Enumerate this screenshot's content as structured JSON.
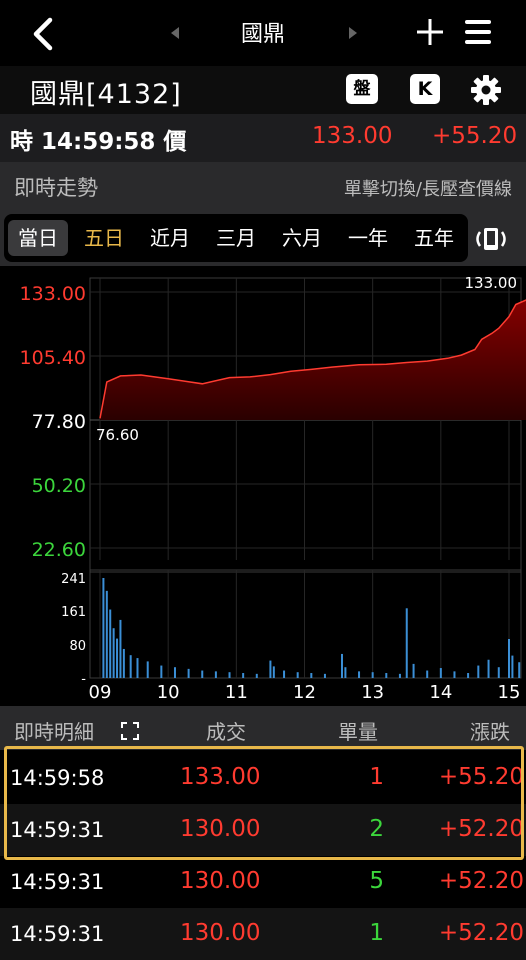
{
  "nav": {
    "title": "國鼎"
  },
  "stock": {
    "name_code": "國鼎[4132]",
    "pan_label": "盤",
    "k_label": "K"
  },
  "quote": {
    "time_label": "時 14:59:58 價",
    "price": "133.00",
    "change": "+55.20"
  },
  "section": {
    "title": "即時走勢",
    "hint": "單擊切換/長壓查價線"
  },
  "tabs": [
    {
      "label": "當日",
      "selected": true
    },
    {
      "label": "五日",
      "active": true
    },
    {
      "label": "近月"
    },
    {
      "label": "三月"
    },
    {
      "label": "六月"
    },
    {
      "label": "一年"
    },
    {
      "label": "五年"
    }
  ],
  "chart_data": {
    "type": "area",
    "price_axis": [
      "133.00",
      "105.40",
      "77.80",
      "50.20",
      "22.60"
    ],
    "price_axis_colors": [
      "#ff3b30",
      "#ff3b30",
      "#ffffff",
      "#3cd63c",
      "#3cd63c"
    ],
    "high_label": "133.00",
    "low_label": "76.60",
    "volume_axis": [
      "241",
      "161",
      "80",
      "-"
    ],
    "x_labels": [
      "09",
      "10",
      "11",
      "12",
      "13",
      "14",
      "15"
    ],
    "ylim_price": [
      22.6,
      133.0
    ],
    "ylim_volume": [
      0,
      241
    ],
    "price_series": [
      [
        0,
        78.5
      ],
      [
        0.1,
        94.2
      ],
      [
        0.3,
        96.8
      ],
      [
        0.6,
        97.2
      ],
      [
        1.0,
        95.6
      ],
      [
        1.5,
        93.4
      ],
      [
        1.9,
        96.1
      ],
      [
        2.2,
        96.4
      ],
      [
        2.5,
        97.4
      ],
      [
        2.8,
        98.8
      ],
      [
        3.1,
        99.6
      ],
      [
        3.4,
        100.6
      ],
      [
        3.8,
        101.6
      ],
      [
        4.2,
        101.8
      ],
      [
        4.5,
        102.6
      ],
      [
        4.8,
        103.2
      ],
      [
        5.1,
        104.4
      ],
      [
        5.3,
        105.8
      ],
      [
        5.5,
        108.2
      ],
      [
        5.6,
        112.6
      ],
      [
        5.75,
        115.2
      ],
      [
        5.85,
        117.4
      ],
      [
        6.0,
        122.4
      ],
      [
        6.1,
        127.6
      ],
      [
        6.35,
        130.8
      ],
      [
        6.6,
        130.4
      ],
      [
        6.9,
        128.6
      ],
      [
        7.2,
        127.2
      ],
      [
        7.5,
        129.8
      ],
      [
        7.8,
        130.4
      ],
      [
        8.1,
        130.6
      ],
      [
        8.4,
        130.2
      ],
      [
        8.7,
        131.4
      ],
      [
        9.0,
        131.6
      ],
      [
        9.25,
        133.0
      ]
    ],
    "volume_series": [
      [
        0.05,
        241
      ],
      [
        0.1,
        210
      ],
      [
        0.15,
        165
      ],
      [
        0.2,
        120
      ],
      [
        0.25,
        95
      ],
      [
        0.3,
        140
      ],
      [
        0.35,
        70
      ],
      [
        0.45,
        55
      ],
      [
        0.55,
        48
      ],
      [
        0.7,
        40
      ],
      [
        0.9,
        30
      ],
      [
        1.1,
        26
      ],
      [
        1.3,
        22
      ],
      [
        1.5,
        18
      ],
      [
        1.7,
        16
      ],
      [
        1.9,
        14
      ],
      [
        2.1,
        12
      ],
      [
        2.3,
        10
      ],
      [
        2.5,
        42
      ],
      [
        2.55,
        28
      ],
      [
        2.7,
        18
      ],
      [
        2.9,
        14
      ],
      [
        3.1,
        12
      ],
      [
        3.3,
        10
      ],
      [
        3.55,
        58
      ],
      [
        3.6,
        26
      ],
      [
        3.8,
        16
      ],
      [
        4.0,
        14
      ],
      [
        4.2,
        12
      ],
      [
        4.4,
        10
      ],
      [
        4.5,
        168
      ],
      [
        4.6,
        34
      ],
      [
        4.8,
        18
      ],
      [
        5.0,
        24
      ],
      [
        5.2,
        16
      ],
      [
        5.4,
        12
      ],
      [
        5.55,
        30
      ],
      [
        5.7,
        44
      ],
      [
        5.85,
        26
      ],
      [
        6.0,
        94
      ],
      [
        6.05,
        54
      ],
      [
        6.15,
        38
      ],
      [
        6.3,
        22
      ],
      [
        6.45,
        18
      ],
      [
        6.6,
        16
      ],
      [
        6.75,
        14
      ],
      [
        6.9,
        12
      ],
      [
        7.05,
        10
      ],
      [
        7.2,
        8
      ],
      [
        7.35,
        10
      ],
      [
        7.5,
        12
      ],
      [
        7.65,
        8
      ],
      [
        7.8,
        10
      ],
      [
        7.95,
        6
      ],
      [
        8.1,
        8
      ],
      [
        8.25,
        12
      ],
      [
        8.4,
        14
      ],
      [
        8.55,
        10
      ],
      [
        8.7,
        8
      ],
      [
        8.85,
        14
      ],
      [
        9.0,
        10
      ],
      [
        9.1,
        22
      ],
      [
        9.2,
        36
      ]
    ]
  },
  "detail": {
    "title": "即時明細",
    "headers": {
      "price": "成交",
      "volume": "單量",
      "change": "漲跌"
    },
    "rows": [
      {
        "time": "14:59:58",
        "price": "133.00",
        "volume": "1",
        "change": "+55.20",
        "vol_color": "#ff3b30"
      },
      {
        "time": "14:59:31",
        "price": "130.00",
        "volume": "2",
        "change": "+52.20",
        "vol_color": "#3cd63c"
      },
      {
        "time": "14:59:31",
        "price": "130.00",
        "volume": "5",
        "change": "+52.20",
        "vol_color": "#3cd63c"
      },
      {
        "time": "14:59:31",
        "price": "130.00",
        "volume": "1",
        "change": "+52.20",
        "vol_color": "#3cd63c"
      }
    ]
  }
}
